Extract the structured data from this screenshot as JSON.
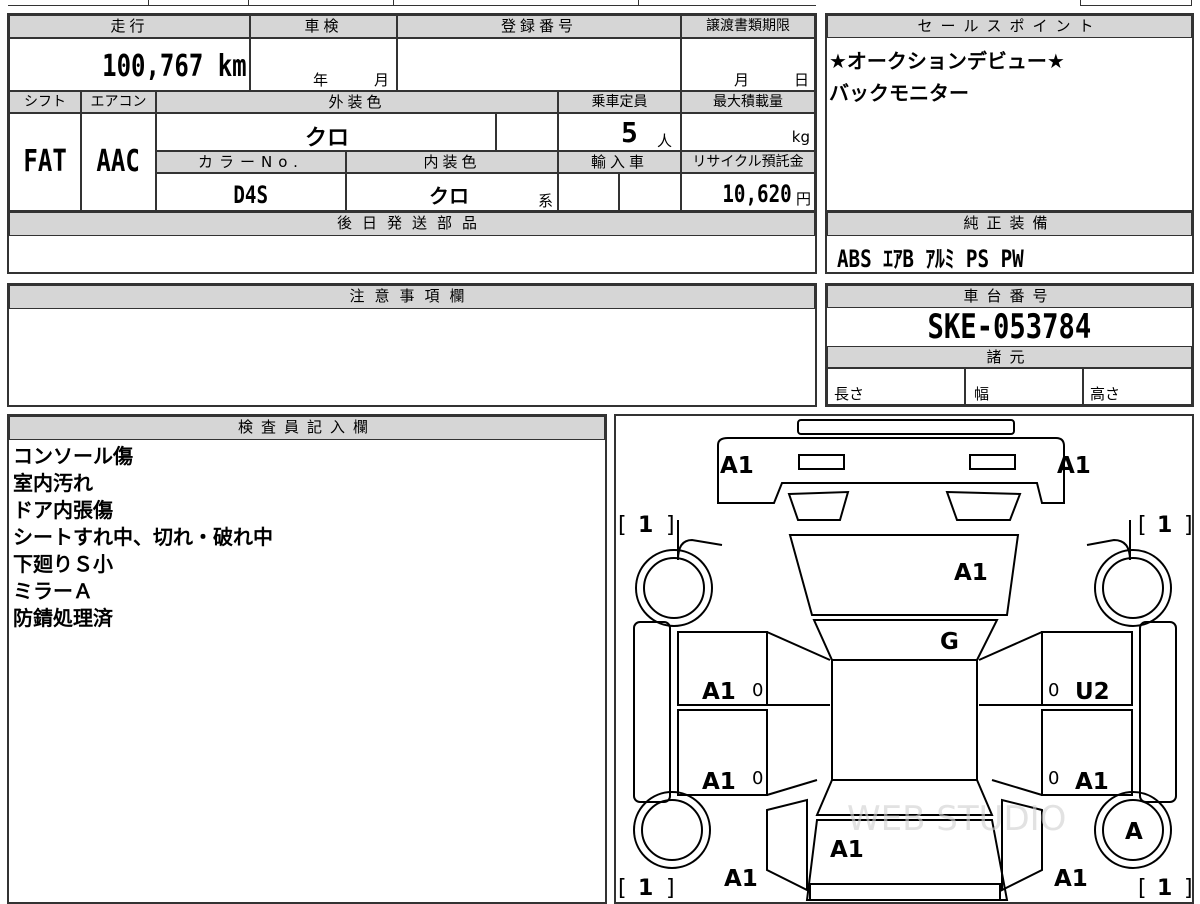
{
  "header": {
    "mileage_label": "走行",
    "shaken_label": "車検",
    "registration_label": "登録番号",
    "transfer_deadline_label": "譲渡書類期限",
    "mileage_value": "100,767 km",
    "year_unit": "年",
    "month_unit": "月",
    "deadline_month": "月",
    "deadline_day": "日"
  },
  "specs": {
    "shift_label": "シフト",
    "aircon_label": "エアコン",
    "exterior_color_label": "外装色",
    "capacity_label": "乗車定員",
    "max_load_label": "最大積載量",
    "shift_value": "FAT",
    "aircon_value": "AAC",
    "exterior_color_value": "クロ",
    "capacity_value": "5",
    "capacity_unit": "人",
    "max_load_unit": "kg",
    "color_no_label": "カラーNo.",
    "interior_color_label": "内装色",
    "import_label": "輸入車",
    "recycle_label": "リサイクル預託金",
    "color_no_value": "D4S",
    "interior_color_value": "クロ",
    "interior_suffix": "系",
    "recycle_value": "10,620",
    "recycle_unit": "円"
  },
  "later_parts": {
    "label": "後日発送部品"
  },
  "sales_points": {
    "label": "セールスポイント",
    "lines": [
      "★オークションデビュー★",
      "バックモニター"
    ]
  },
  "standard_equipment": {
    "label": "純正装備",
    "value": "ABS ｴｱB ｱﾙﾐ PS PW"
  },
  "notes": {
    "label": "注意事項欄"
  },
  "chassis": {
    "label": "車台番号",
    "value": "SKE-053784"
  },
  "dimensions": {
    "label": "諸元",
    "length": "長さ",
    "width": "幅",
    "height": "高さ"
  },
  "inspector": {
    "label": "検査員記入欄",
    "lines": [
      "コンソール傷",
      "室内汚れ",
      "ドア内張傷",
      "シートすれ中、切れ・破れ中",
      "下廻りＳ小",
      "ミラーＡ",
      "防錆処理済"
    ]
  },
  "diagram": {
    "front_left_fender": "A1",
    "front_right_fender": "A1",
    "tire_front_left": "1",
    "tire_front_right": "1",
    "tire_rear_left": "1",
    "tire_rear_right": "1",
    "bracket_open": "[",
    "bracket_close": "]",
    "hood": "A1",
    "windshield": "G",
    "front_left_door": "A1",
    "front_right_door": "U2",
    "rear_left_door": "A1",
    "rear_right_door": "A1",
    "door_zero": "0",
    "rear_right_wheel": "A",
    "trunk": "A1",
    "rear_left_quarter": "A1",
    "rear_right_quarter": "A1",
    "watermark": "WEB STUDIO"
  }
}
